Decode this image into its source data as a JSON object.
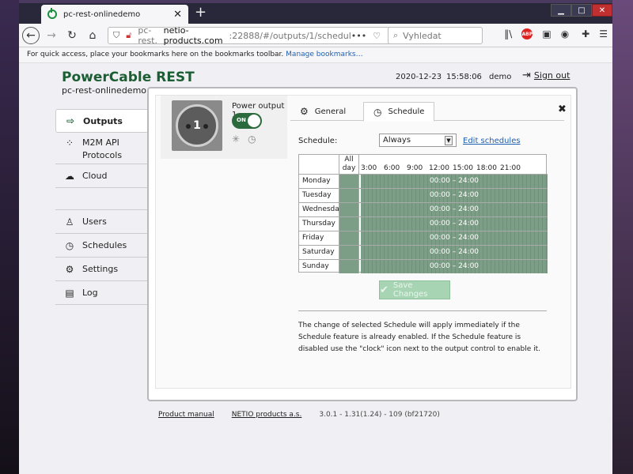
{
  "browser": {
    "tab_title": "pc-rest-onlinedemo",
    "tab_close": "✕",
    "new_tab": "+",
    "url_prefix": "pc-rest.",
    "url_domain": "netio-products.com",
    "url_path": ":22888/#/outputs/1/schedul",
    "url_more": "•••",
    "search_placeholder": "Vyhledat",
    "bookmarks_text": "For quick access, place your bookmarks here on the bookmarks toolbar.",
    "bookmarks_link": "Manage bookmarks…",
    "adblock_label": "ABP"
  },
  "header": {
    "brand": "PowerCable REST",
    "device": "pc-rest-onlinedemo",
    "date": "2020-12-23",
    "time": "15:58:06",
    "user": "demo",
    "signout": "Sign out"
  },
  "sidebar": {
    "items": [
      {
        "label": "Outputs"
      },
      {
        "label": "M2M API Protocols"
      },
      {
        "label": "Cloud"
      },
      {
        "label": "Users"
      },
      {
        "label": "Schedules"
      },
      {
        "label": "Settings"
      },
      {
        "label": "Log"
      }
    ]
  },
  "output": {
    "number": "1",
    "name": "Power output 1",
    "state": "ON"
  },
  "tabs": {
    "general": "General",
    "schedule": "Schedule",
    "close": "✖"
  },
  "schedule": {
    "label": "Schedule:",
    "selected": "Always",
    "edit_link": "Edit schedules",
    "allday_header": "All day",
    "hours": [
      "3:00",
      "6:00",
      "9:00",
      "12:00",
      "15:00",
      "18:00",
      "21:00"
    ],
    "days": [
      {
        "day": "Monday",
        "range": "00:00 – 24:00"
      },
      {
        "day": "Tuesday",
        "range": "00:00 – 24:00"
      },
      {
        "day": "Wednesday",
        "range": "00:00 – 24:00"
      },
      {
        "day": "Thursday",
        "range": "00:00 – 24:00"
      },
      {
        "day": "Friday",
        "range": "00:00 – 24:00"
      },
      {
        "day": "Saturday",
        "range": "00:00 – 24:00"
      },
      {
        "day": "Sunday",
        "range": "00:00 – 24:00"
      }
    ],
    "save_label": "Save Changes",
    "note": "The change of selected Schedule will apply immediately if the Schedule feature is already enabled. If the Schedule feature is disabled use the \"clock\" icon next to the output control to enable it."
  },
  "footer": {
    "manual": "Product manual",
    "company": "NETIO products a.s.",
    "version": "3.0.1 - 1.31(1.24) - 109 (bf21720)"
  },
  "colors": {
    "brand_green": "#1c5e34",
    "schedule_fill": "#7d9e86",
    "save_disabled": "#a7d4b2"
  }
}
